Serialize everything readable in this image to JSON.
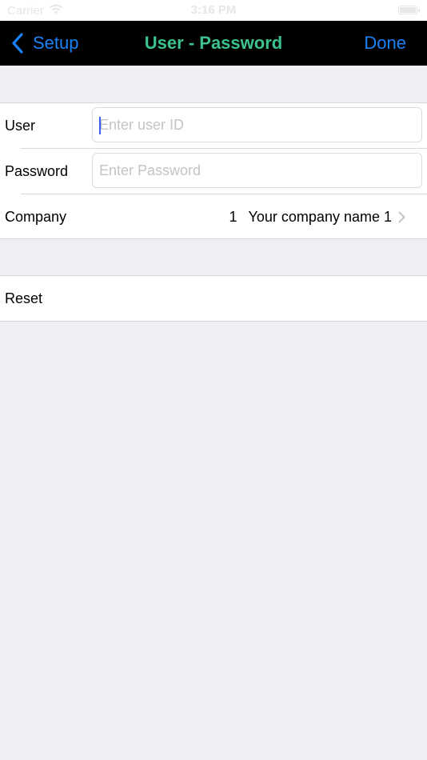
{
  "status_bar": {
    "carrier": "Carrier",
    "time": "3:16 PM"
  },
  "nav": {
    "back_label": "Setup",
    "title": "User - Password",
    "done_label": "Done",
    "accent_color": "#1a82f7",
    "title_color": "#3cc28c"
  },
  "form": {
    "user": {
      "label": "User",
      "placeholder": "Enter user ID",
      "value": ""
    },
    "password": {
      "label": "Password",
      "placeholder": "Enter Password",
      "value": ""
    },
    "company": {
      "label": "Company",
      "number": "1",
      "name": "Your company name 1"
    }
  },
  "reset": {
    "label": "Reset"
  }
}
